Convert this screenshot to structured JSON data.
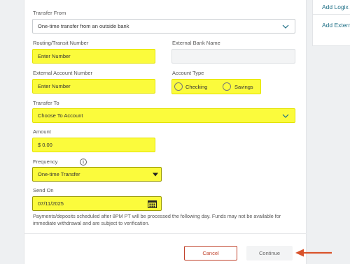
{
  "sidebar_links": [
    "Add Logix Ac",
    "Add External"
  ],
  "form": {
    "transfer_from": {
      "label": "Transfer From",
      "value": "One-time transfer from an outside bank"
    },
    "routing": {
      "label": "Routing/Transit Number",
      "placeholder": "Enter Number"
    },
    "external_bank": {
      "label": "External Bank Name",
      "value": ""
    },
    "external_account": {
      "label": "External Account Number",
      "placeholder": "Enter Number"
    },
    "account_type": {
      "label": "Account Type",
      "options": [
        "Checking",
        "Savings"
      ]
    },
    "transfer_to": {
      "label": "Transfer To",
      "value": "Choose To Account"
    },
    "amount": {
      "label": "Amount",
      "value": "$ 0.00"
    },
    "frequency": {
      "label": "Frequency",
      "info_glyph": "i",
      "value": "One-time Transfer"
    },
    "send_on": {
      "label": "Send On",
      "value": "07/11/2025"
    },
    "note": "Payments/deposits scheduled after 8PM PT will be processed the following day. Funds may not be available for immediate withdrawal and are subject to verification."
  },
  "buttons": {
    "cancel": "Cancel",
    "continue": "Continue"
  },
  "colors": {
    "highlight": "#fbfb3c",
    "accent": "#1e6f86",
    "cancel": "#c1432c",
    "arrow": "#d9532b"
  },
  "icons": [
    "chevron-down-icon",
    "info-icon",
    "calendar-icon",
    "arrow-left-icon"
  ]
}
